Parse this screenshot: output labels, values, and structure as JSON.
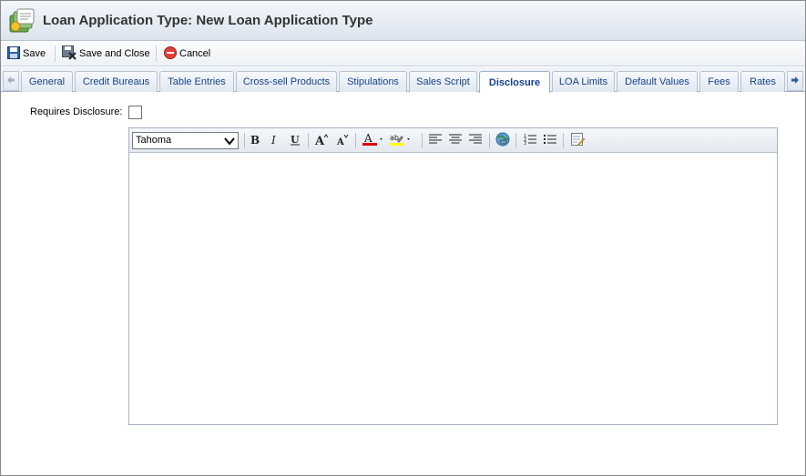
{
  "window": {
    "title": "Loan Application Type: New Loan Application Type"
  },
  "toolbar": {
    "save_label": "Save",
    "save_close_label": "Save and Close",
    "cancel_label": "Cancel"
  },
  "tabs": [
    {
      "label": "General"
    },
    {
      "label": "Credit Bureaus"
    },
    {
      "label": "Table Entries"
    },
    {
      "label": "Cross-sell Products"
    },
    {
      "label": "Stipulations"
    },
    {
      "label": "Sales Script"
    },
    {
      "label": "Disclosure",
      "active": true
    },
    {
      "label": "LOA Limits"
    },
    {
      "label": "Default Values"
    },
    {
      "label": "Fees"
    },
    {
      "label": "Rates"
    }
  ],
  "form": {
    "requires_disclosure_label": "Requires Disclosure:",
    "requires_disclosure_checked": false
  },
  "editor": {
    "font_value": "Tahoma",
    "content": ""
  },
  "colors": {
    "tab_text": "#15428b",
    "font_color_bar": "#e00000",
    "highlight_bar": "#ffff00"
  },
  "icons": [
    "app-icon",
    "save-icon",
    "save-close-icon",
    "cancel-icon",
    "scroll-left-icon",
    "scroll-right-icon",
    "bold-icon",
    "italic-icon",
    "underline-icon",
    "grow-font-icon",
    "shrink-font-icon",
    "font-color-icon",
    "highlight-icon",
    "align-left-icon",
    "align-center-icon",
    "align-right-icon",
    "insert-link-icon",
    "ordered-list-icon",
    "unordered-list-icon",
    "source-edit-icon"
  ]
}
